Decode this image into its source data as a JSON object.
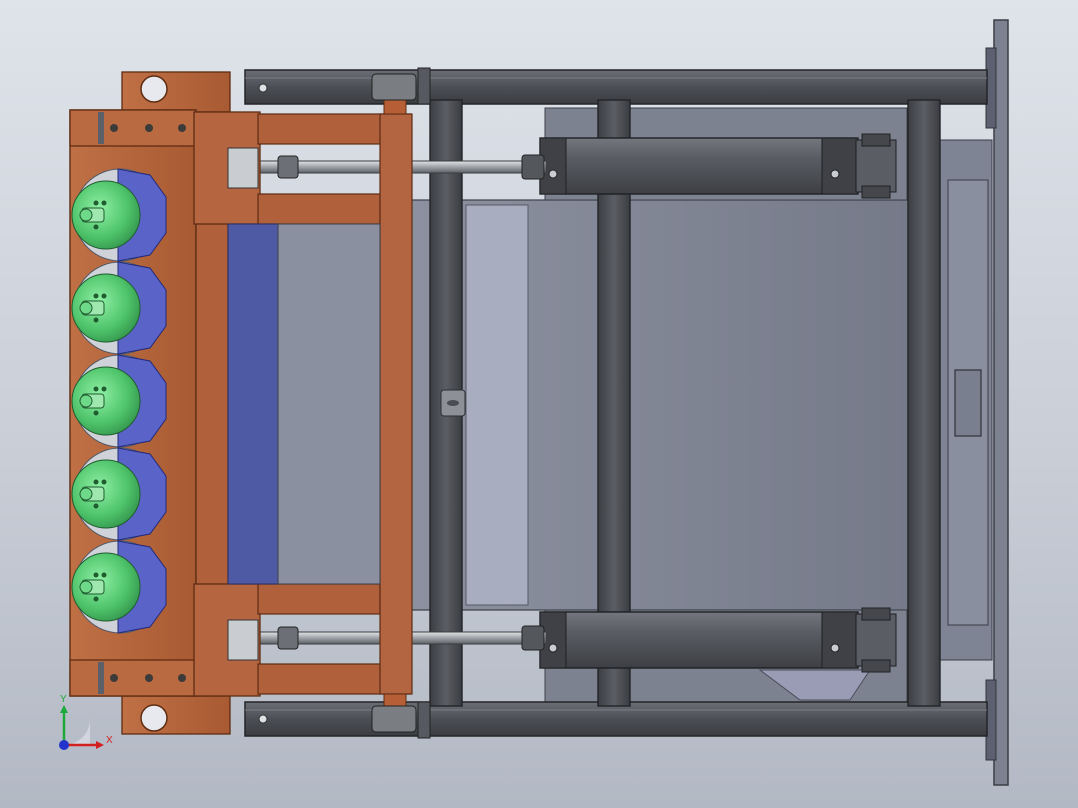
{
  "viewport": {
    "background_top": "#dfe3ea",
    "background_bottom": "#b3b9c4"
  },
  "colors": {
    "copper": "#b4643c",
    "copper_dark": "#8a4523",
    "frame_gray": "#4f5257",
    "frame_edge": "#2b2d30",
    "plate_gray": "#7c8190",
    "plate_light": "#a9aec0",
    "panel_blue": "#4e5aa3",
    "roller_green": "#5fd07a",
    "roller_blue": "#5a63c8",
    "silver": "#c4c7cc"
  },
  "triad": {
    "x_label": "X",
    "y_label": "Y",
    "x_color": "#d21f1f",
    "y_color": "#1fa83b",
    "z_color": "#2233cc"
  },
  "assembly": {
    "roller_count": 5
  }
}
